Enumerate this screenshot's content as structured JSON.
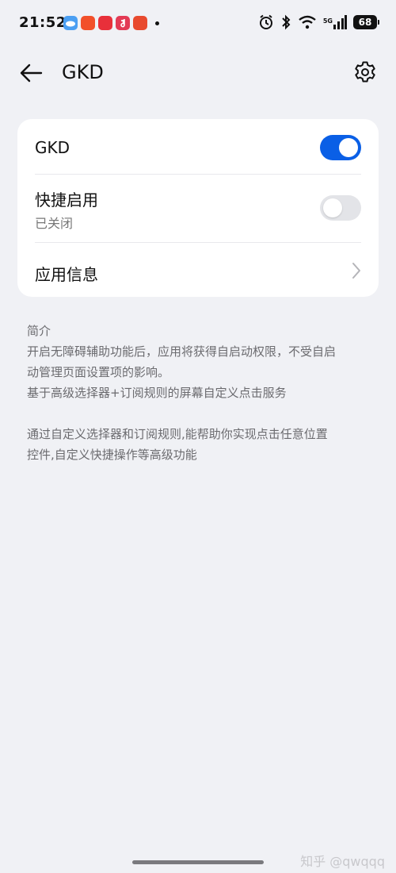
{
  "status_bar": {
    "time": "21:52",
    "app_icons": [
      "weather-icon",
      "app-icon",
      "xiaohongshu-icon",
      "music-icon",
      "game-icon"
    ],
    "network": "5G",
    "battery": "68"
  },
  "header": {
    "title": "GKD"
  },
  "settings_card": {
    "gkd_toggle": {
      "label": "GKD",
      "enabled": true
    },
    "quick_enable": {
      "label": "快捷启用",
      "status": "已关闭",
      "enabled": false
    },
    "app_info": {
      "label": "应用信息"
    }
  },
  "intro": {
    "heading": "简介",
    "line1": "开启无障碍辅助功能后，应用将获得自启动权限，不受自启",
    "line2": "动管理页面设置项的影响。",
    "line3": "基于高级选择器+订阅规则的屏幕自定义点击服务",
    "line4": "通过自定义选择器和订阅规则,能帮助你实现点击任意位置",
    "line5": "控件,自定义快捷操作等高级功能"
  },
  "watermark": "知乎 @qwqqq",
  "colors": {
    "accent": "#0a5fe6",
    "background": "#f0f1f5",
    "card": "#ffffff",
    "secondary_text": "#777777"
  }
}
